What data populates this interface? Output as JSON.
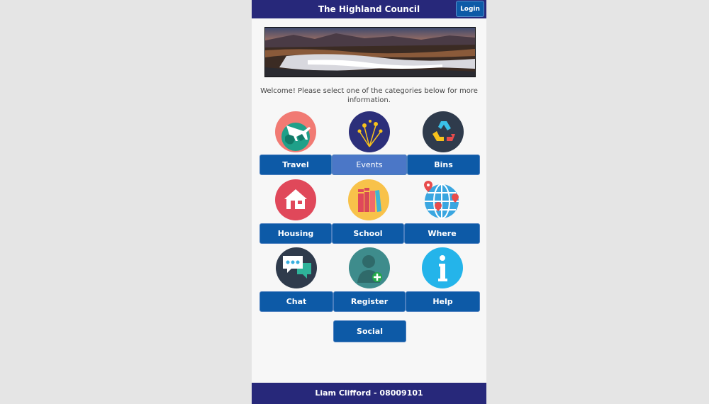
{
  "header": {
    "title": "The Highland Council",
    "login_label": "Login"
  },
  "welcome_text": "Welcome! Please select one of the categories below for more information.",
  "categories": [
    {
      "label": "Travel",
      "icon": "plane-globe-icon"
    },
    {
      "label": "Events",
      "icon": "fireworks-icon"
    },
    {
      "label": "Bins",
      "icon": "recycle-icon"
    },
    {
      "label": "Housing",
      "icon": "house-icon"
    },
    {
      "label": "School",
      "icon": "books-icon"
    },
    {
      "label": "Where",
      "icon": "globe-pins-icon"
    },
    {
      "label": "Chat",
      "icon": "chat-bubbles-icon"
    },
    {
      "label": "Register",
      "icon": "user-add-icon"
    },
    {
      "label": "Help",
      "icon": "info-icon"
    },
    {
      "label": "Social"
    }
  ],
  "footer": {
    "text": "Liam Clifford - 08009101"
  },
  "colors": {
    "header_bg": "#27287a",
    "button_bg": "#0d5aa7",
    "active_button_bg": "#4b77c7",
    "page_bg": "#f7f7f7"
  }
}
